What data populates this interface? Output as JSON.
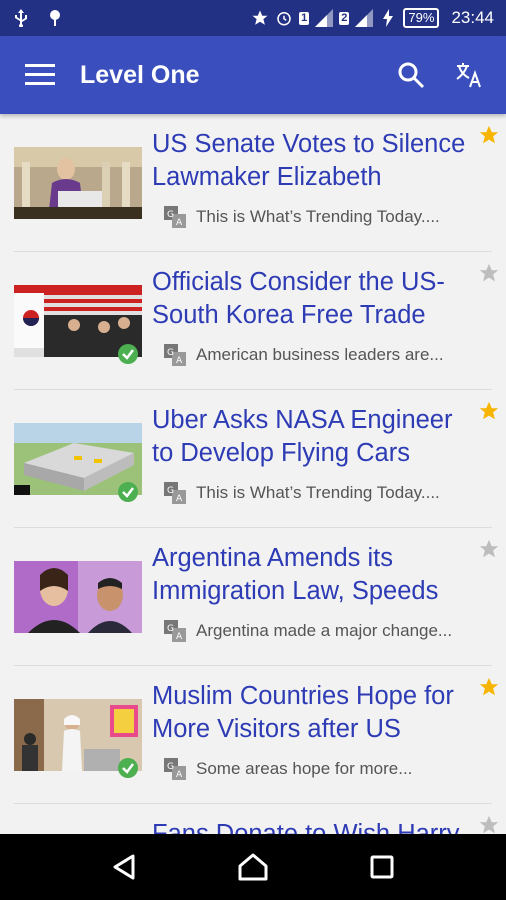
{
  "status_bar": {
    "sim1": "1",
    "sim2": "2",
    "battery": "79%",
    "time": "23:44"
  },
  "app_bar": {
    "title": "Level One"
  },
  "articles": [
    {
      "title_line1": "US Senate Votes to Silence",
      "title_line2": "Lawmaker Elizabeth",
      "snippet": "This is What’s Trending Today....",
      "starred": true,
      "read": false
    },
    {
      "title_line1": "Officials Consider the US-",
      "title_line2": "South Korea Free Trade",
      "snippet": "American business leaders are...",
      "starred": false,
      "read": true
    },
    {
      "title_line1": "Uber Asks NASA Engineer",
      "title_line2": "to Develop Flying Cars",
      "snippet": "This is What’s Trending Today....",
      "starred": true,
      "read": true
    },
    {
      "title_line1": "Argentina Amends its",
      "title_line2": "Immigration Law, Speeds",
      "snippet": "Argentina made a major change...",
      "starred": false,
      "read": false
    },
    {
      "title_line1": "Muslim Countries Hope for",
      "title_line2": "More Visitors after US",
      "snippet": "Some areas hope for more...",
      "starred": true,
      "read": true
    },
    {
      "title_line1": "Fans Donate to Wish Harry",
      "title_line2": "",
      "snippet": "",
      "starred": false,
      "read": false
    }
  ],
  "colors": {
    "status_bar": "#233184",
    "app_bar": "#3a4fbd",
    "title_text": "#2d3bb5",
    "star_on": "#f7b500",
    "star_off": "#bdbdbd",
    "check": "#4caf50"
  }
}
